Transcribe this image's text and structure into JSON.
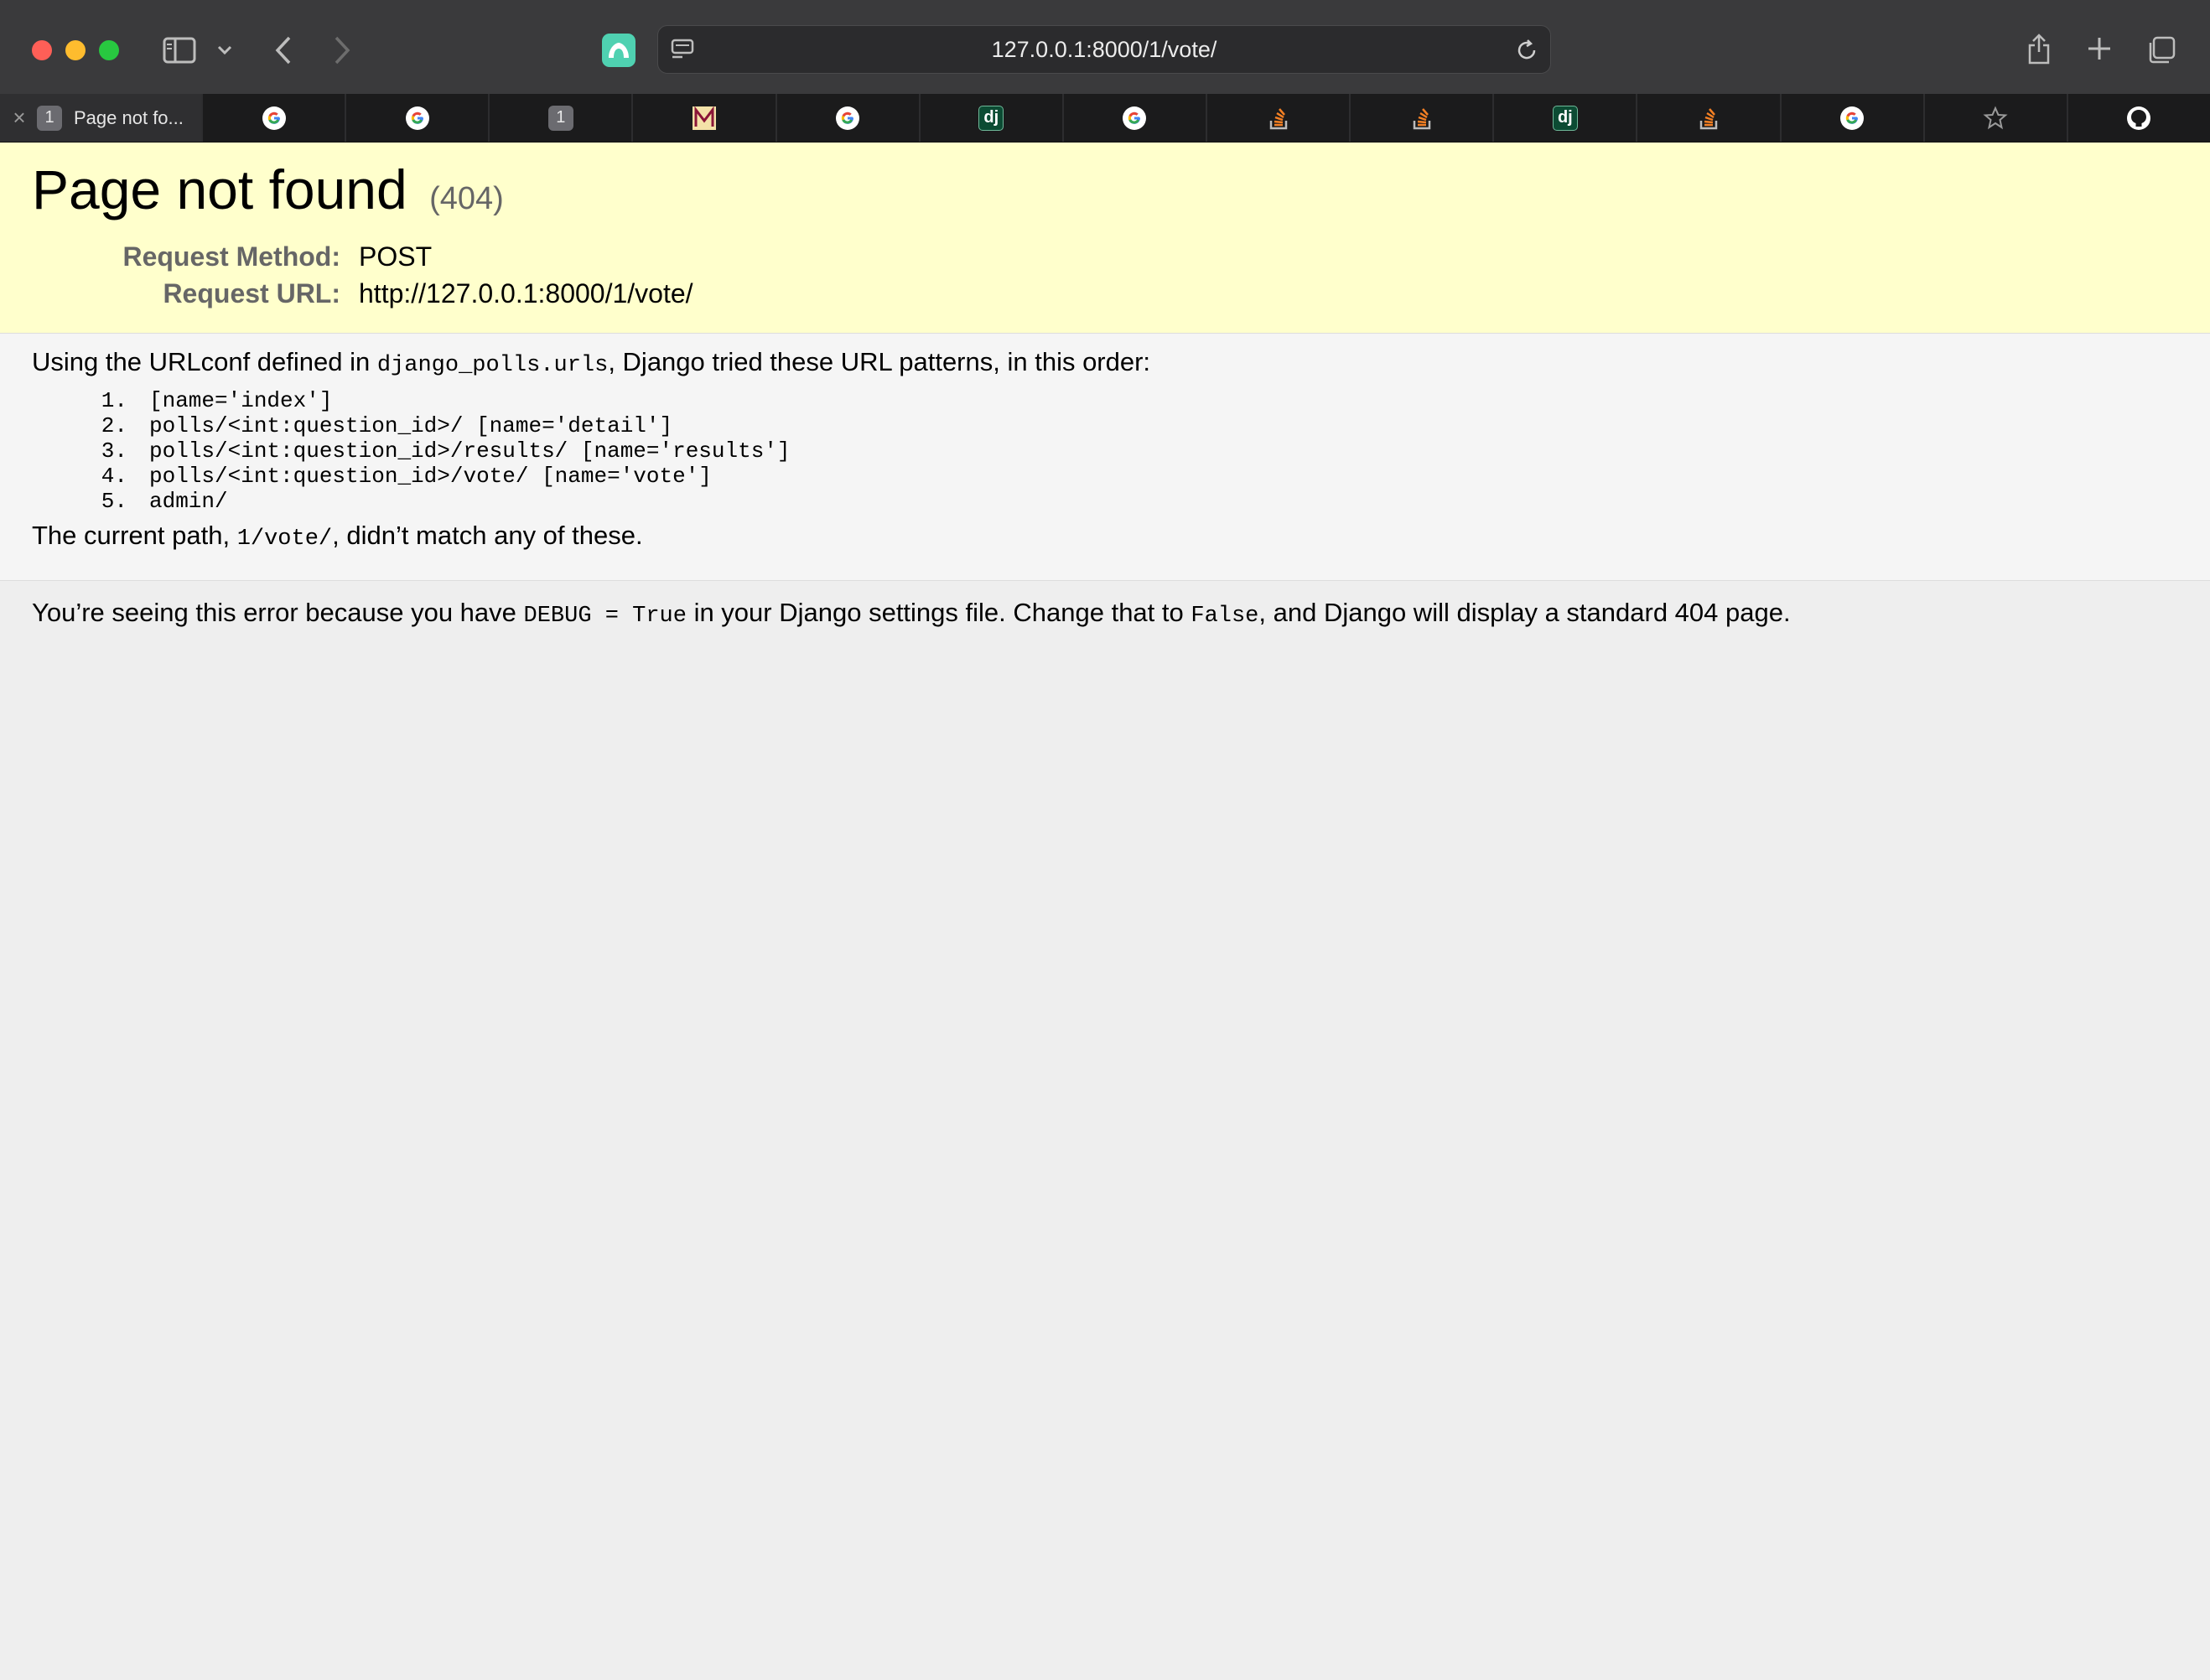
{
  "browser": {
    "url": "127.0.0.1:8000/1/vote/",
    "active_tab": {
      "badge": "1",
      "title": "Page not fo..."
    },
    "tabs": [
      {
        "icon": "google-icon"
      },
      {
        "icon": "google-icon"
      },
      {
        "icon": "number-badge-icon",
        "badge": "1"
      },
      {
        "icon": "m-logo-icon"
      },
      {
        "icon": "google-icon"
      },
      {
        "icon": "django-icon",
        "badge": "dj"
      },
      {
        "icon": "google-icon"
      },
      {
        "icon": "stackoverflow-icon"
      },
      {
        "icon": "stackoverflow-icon"
      },
      {
        "icon": "django-icon",
        "badge": "dj"
      },
      {
        "icon": "stackoverflow-icon"
      },
      {
        "icon": "google-icon"
      },
      {
        "icon": "star-icon"
      },
      {
        "icon": "github-icon"
      }
    ],
    "colors": {
      "close": "#ff5f57",
      "minimize": "#febc2e",
      "zoom": "#28c840",
      "extension": "#4fd1b1"
    }
  },
  "error_page": {
    "title": "Page not found",
    "status": "(404)",
    "request_method_label": "Request Method:",
    "request_method": "POST",
    "request_url_label": "Request URL:",
    "request_url": "http://127.0.0.1:8000/1/vote/",
    "urlconf_intro_before": "Using the URLconf defined in ",
    "urlconf_module": "django_polls.urls",
    "urlconf_intro_after": ", Django tried these URL patterns, in this order:",
    "patterns": [
      {
        "num": "1.",
        "text": "[name='index']"
      },
      {
        "num": "2.",
        "text": "polls/<int:question_id>/ [name='detail']"
      },
      {
        "num": "3.",
        "text": "polls/<int:question_id>/results/ [name='results']"
      },
      {
        "num": "4.",
        "text": "polls/<int:question_id>/vote/ [name='vote']"
      },
      {
        "num": "5.",
        "text": "admin/"
      }
    ],
    "current_path_before": "The current path, ",
    "current_path": "1/vote/",
    "current_path_after": ", didn’t match any of these.",
    "explanation_before": "You’re seeing this error because you have ",
    "debug_setting": "DEBUG = True",
    "explanation_middle": " in your Django settings file. Change that to ",
    "false_value": "False",
    "explanation_after": ", and Django will display a standard 404 page.",
    "colors": {
      "summary_bg": "#ffffcc",
      "info_bg": "#f5f5f5",
      "page_bg": "#eeeeee"
    }
  }
}
